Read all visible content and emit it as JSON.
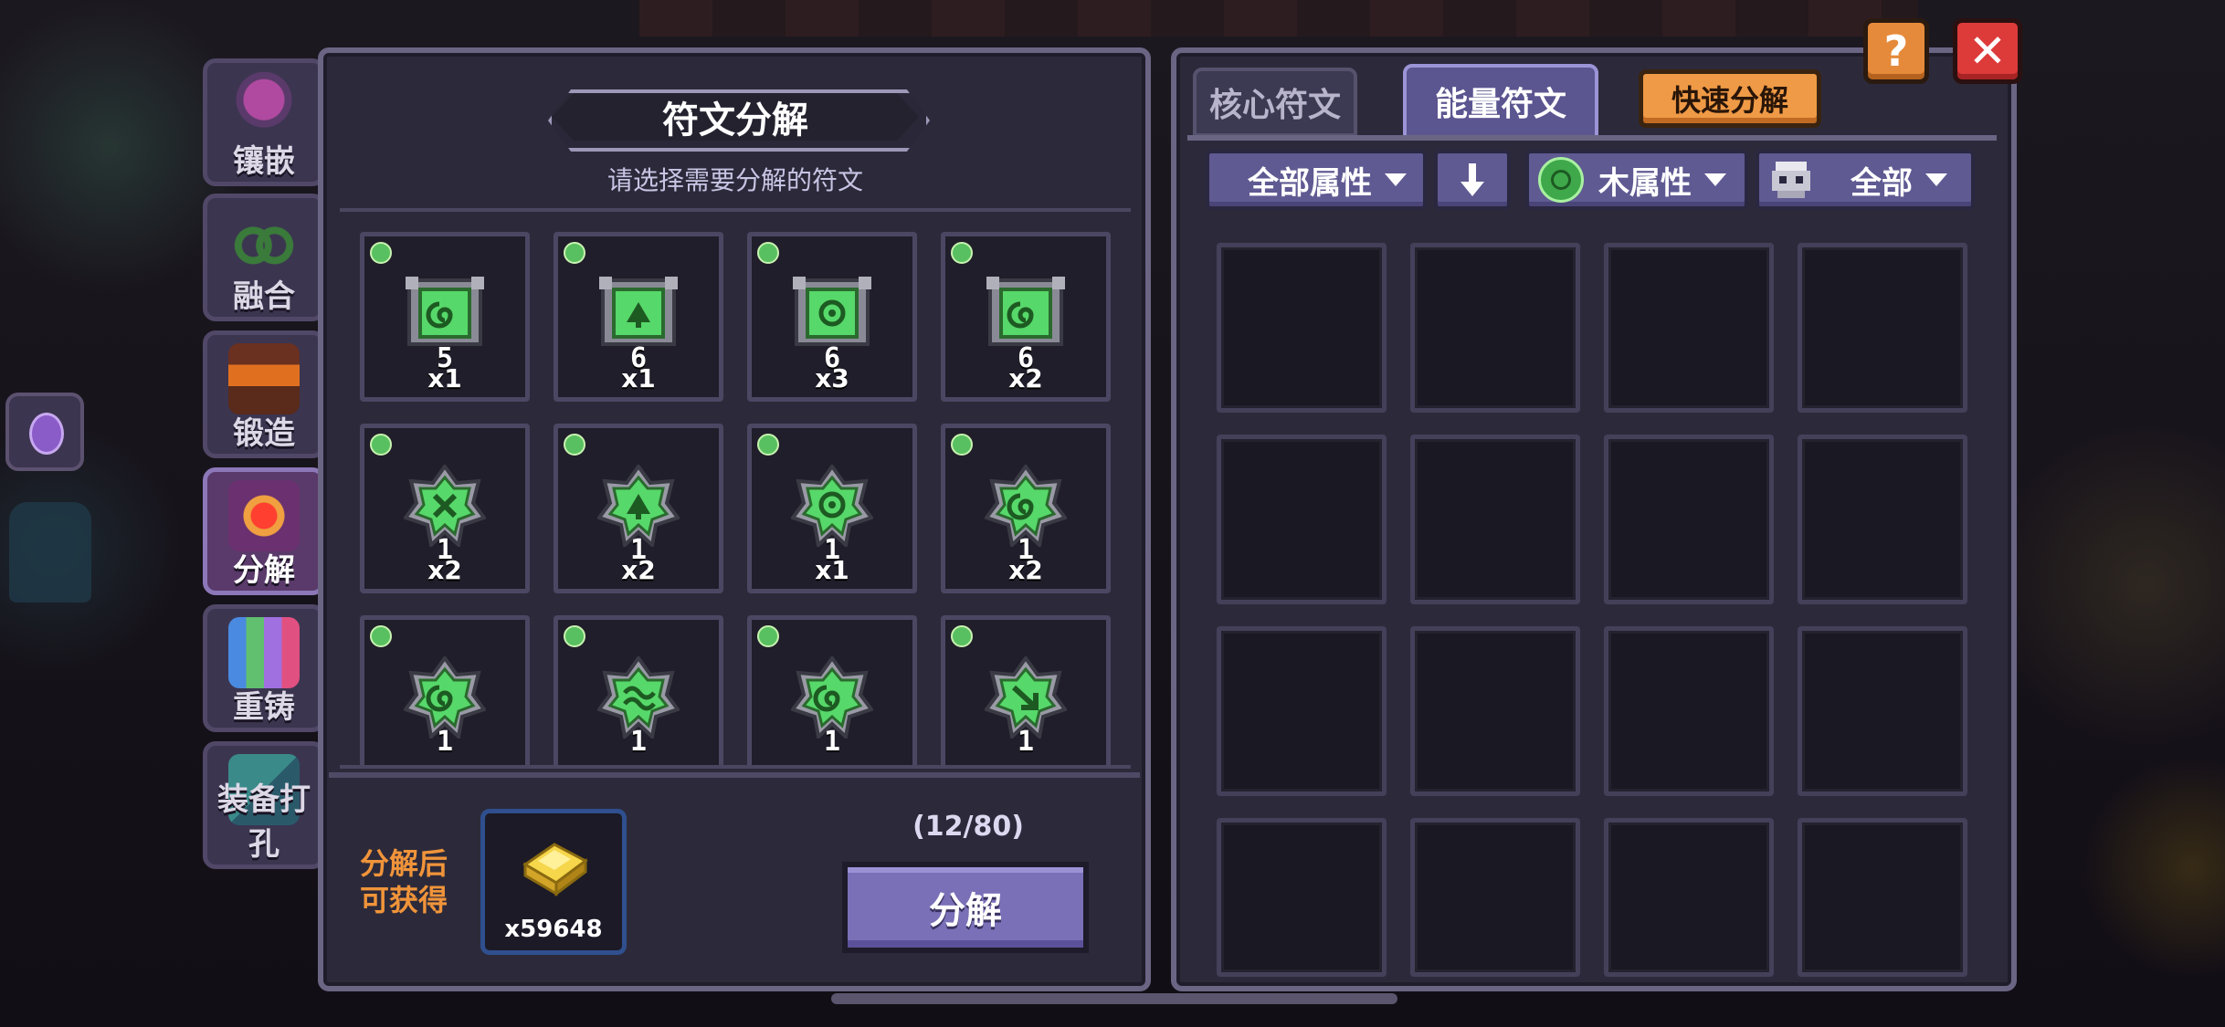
{
  "side_tabs": [
    {
      "label": "镶嵌",
      "icon": "inlay-icon",
      "active": false
    },
    {
      "label": "融合",
      "icon": "fusion-icon",
      "active": false
    },
    {
      "label": "锻造",
      "icon": "forge-icon",
      "active": false
    },
    {
      "label": "分解",
      "icon": "decompose-icon",
      "active": true
    },
    {
      "label": "重铸",
      "icon": "recast-icon",
      "active": false
    },
    {
      "label": "装备打孔",
      "icon": "socket-icon",
      "active": false
    }
  ],
  "left": {
    "title": "符文分解",
    "subtitle": "请选择需要分解的符文",
    "runes": [
      {
        "level": "5",
        "qty": "x1",
        "shape": "tablet",
        "glyph": "swirl"
      },
      {
        "level": "6",
        "qty": "x1",
        "shape": "tablet",
        "glyph": "leaf"
      },
      {
        "level": "6",
        "qty": "x3",
        "shape": "tablet",
        "glyph": "ring"
      },
      {
        "level": "6",
        "qty": "x2",
        "shape": "tablet",
        "glyph": "swirl"
      },
      {
        "level": "1",
        "qty": "x2",
        "shape": "star",
        "glyph": "cross"
      },
      {
        "level": "1",
        "qty": "x2",
        "shape": "star",
        "glyph": "leaf"
      },
      {
        "level": "1",
        "qty": "x1",
        "shape": "star",
        "glyph": "ring"
      },
      {
        "level": "1",
        "qty": "x2",
        "shape": "star",
        "glyph": "swirl"
      },
      {
        "level": "1",
        "qty": "",
        "shape": "star",
        "glyph": "swirl"
      },
      {
        "level": "1",
        "qty": "",
        "shape": "star",
        "glyph": "wave"
      },
      {
        "level": "1",
        "qty": "",
        "shape": "star",
        "glyph": "swirl"
      },
      {
        "level": "1",
        "qty": "",
        "shape": "star",
        "glyph": "arrow"
      }
    ],
    "reward_label": "分解后可获得",
    "reward_qty": "x59648",
    "capacity": "(12/80)",
    "decompose_label": "分解"
  },
  "right": {
    "tab_core": "核心符文",
    "tab_energy": "能量符文",
    "quick_label": "快速分解",
    "filter_attr": "全部属性",
    "filter_element": "木属性",
    "filter_all": "全部",
    "empty_slots": 16
  },
  "colors": {
    "rune_green": "#57d86a",
    "button_purple": "#7a70b8",
    "accent_orange": "#ef9a46",
    "close_red": "#dd3a3a"
  }
}
